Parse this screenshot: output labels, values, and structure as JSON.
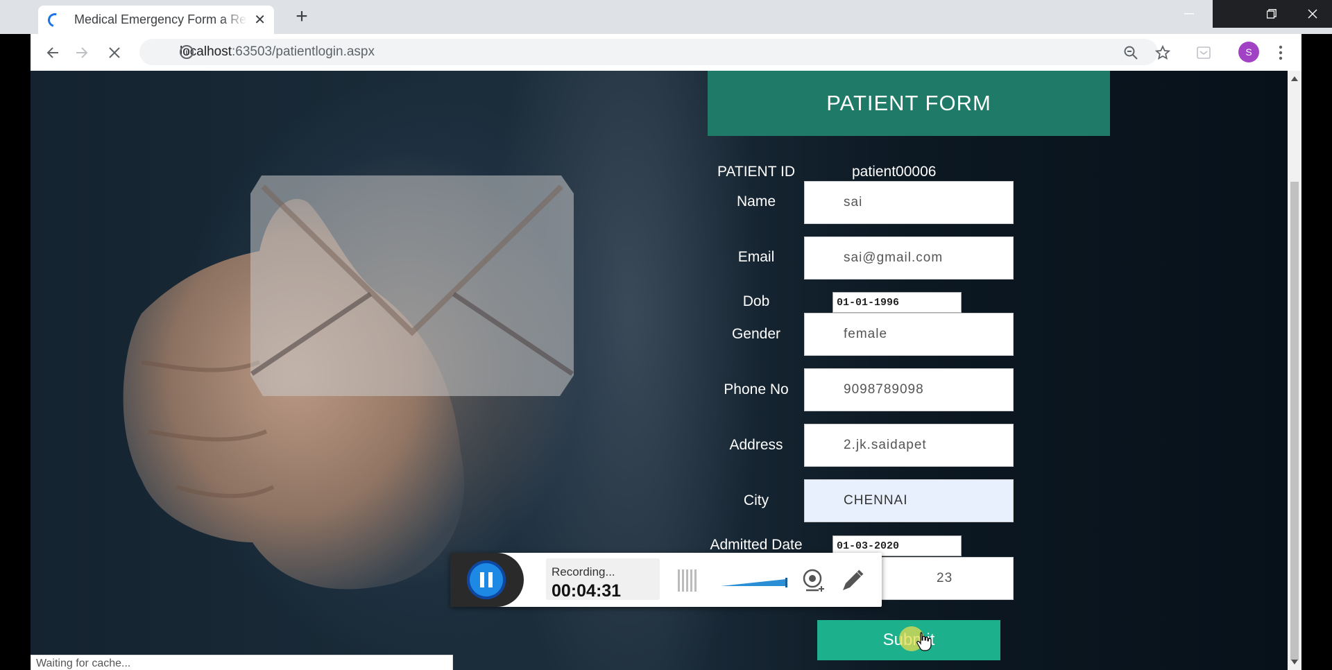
{
  "tab": {
    "title": "Medical Emergency Form a Response",
    "close": "✕"
  },
  "newtab": "+",
  "address": {
    "host": "localhost",
    "path": ":63503/patientlogin.aspx"
  },
  "profile_initial": "S",
  "form": {
    "title": "PATIENT FORM",
    "patient_id_label": "PATIENT ID",
    "patient_id_value": "patient00006",
    "name_label": "Name",
    "name_value": "sai",
    "email_label": "Email",
    "email_value": "sai@gmail.com",
    "dob_label": "Dob",
    "dob_value": "01-01-1996",
    "gender_label": "Gender",
    "gender_value": "female",
    "phone_label": "Phone No",
    "phone_value": "9098789098",
    "address_label": "Address",
    "address_value": "2.jk.saidapet",
    "city_label": "City",
    "city_value": "CHENNAI",
    "admitted_label": "Admitted Date",
    "admitted_value": "01-03-2020",
    "extra_value": "23",
    "submit_label": "Submit"
  },
  "recorder": {
    "status": "Recording...",
    "time": "00:04:31"
  },
  "status_bar": "Waiting for cache..."
}
